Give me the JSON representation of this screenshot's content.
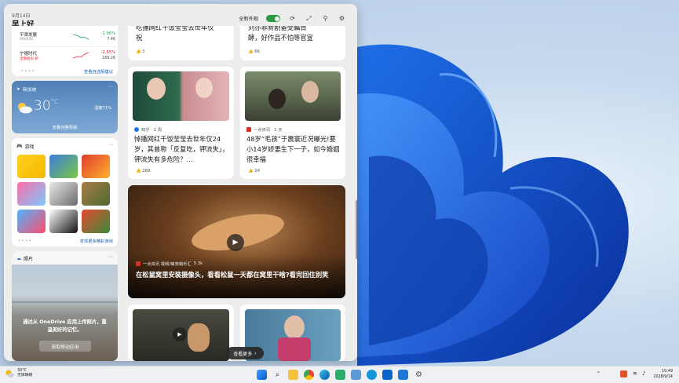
{
  "header": {
    "date": "9月14日",
    "greeting": "早上好",
    "toggle_label": "全新外观"
  },
  "stocks": {
    "items": [
      {
        "name": "平潭发展",
        "code": "000592",
        "change": "-1.96%",
        "price": "7.46"
      },
      {
        "name": "宁德时代",
        "code": "宝钢股份 新",
        "change": "-2.65%",
        "price": "169.26"
      }
    ],
    "link": "查看自选股建议"
  },
  "weather": {
    "location": "新加坡",
    "temp": "30",
    "unit": "°C",
    "humidity": "湿度71%",
    "link": "查看完整预报"
  },
  "games": {
    "title": "游戏",
    "link": "发现更多精彩游戏"
  },
  "photos": {
    "title": "照片",
    "message": "通过从 OneDrive 应用上传照片，重温美好的记忆。",
    "button": "获取移动应用"
  },
  "news": [
    {
      "title_tail": "祝",
      "likes": "3"
    },
    {
      "title_tail": "酵，好作品不怕等官宣",
      "likes": "66"
    },
    {
      "source": "知乎 · 1 周",
      "title": "悼播网红千饭莹莹去世年仅24 岁，其曾称「反复吃，钾流失」，钾流失有多危险？…",
      "likes": "289"
    },
    {
      "source": "一点资讯 · 1 天",
      "title": "48岁“毛孩”于震寰近况曝光!要小14岁娇妻生下一子，如今婚姻很幸福",
      "likes": "24"
    },
    {
      "source": "一点资讯 视频/萌宠萌乐汇",
      "views": "5.3k",
      "title": "在松鼠窝里安装摄像头，看看松鼠一天都在窝里干啥?看完回住别笑"
    }
  ],
  "see_more": "查看更多",
  "taskbar": {
    "weather_temp": "30°C",
    "weather_desc": "无阳晴朗",
    "time": "10:49",
    "date": "2028/9/14"
  }
}
